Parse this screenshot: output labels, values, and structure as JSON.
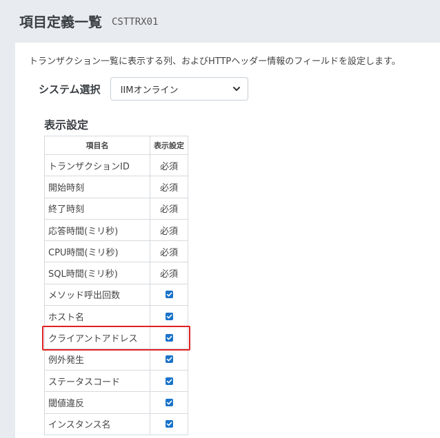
{
  "header": {
    "title": "項目定義一覧",
    "screen_id": "CSTTRX01"
  },
  "description": "トランザクション一覧に表示する列、およびHTTPヘッダー情報のフィールドを設定します。",
  "system_select": {
    "label": "システム選択",
    "value": "IIMオンライン",
    "icon": "chevron-down-icon"
  },
  "display_settings": {
    "title": "表示設定",
    "columns": [
      "項目名",
      "表示設定"
    ],
    "rows": [
      {
        "name": "トランザクションID",
        "setting": "必須",
        "type": "required"
      },
      {
        "name": "開始時刻",
        "setting": "必須",
        "type": "required"
      },
      {
        "name": "終了時刻",
        "setting": "必須",
        "type": "required"
      },
      {
        "name": "応答時間(ミリ秒)",
        "setting": "必須",
        "type": "required"
      },
      {
        "name": "CPU時間(ミリ秒)",
        "setting": "必須",
        "type": "required"
      },
      {
        "name": "SQL時間(ミリ秒)",
        "setting": "必須",
        "type": "required"
      },
      {
        "name": "メソッド呼出回数",
        "checked": true,
        "type": "checkbox"
      },
      {
        "name": "ホスト名",
        "checked": true,
        "type": "checkbox"
      },
      {
        "name": "クライアントアドレス",
        "checked": true,
        "type": "checkbox",
        "highlighted": true
      },
      {
        "name": "例外発生",
        "checked": true,
        "type": "checkbox"
      },
      {
        "name": "ステータスコード",
        "checked": true,
        "type": "checkbox"
      },
      {
        "name": "閾値違反",
        "checked": true,
        "type": "checkbox"
      },
      {
        "name": "インスタンス名",
        "checked": true,
        "type": "checkbox"
      }
    ]
  },
  "colors": {
    "checkbox": "#1a73c9",
    "highlight": "#e02020",
    "page_background": "#e8ecf0"
  }
}
